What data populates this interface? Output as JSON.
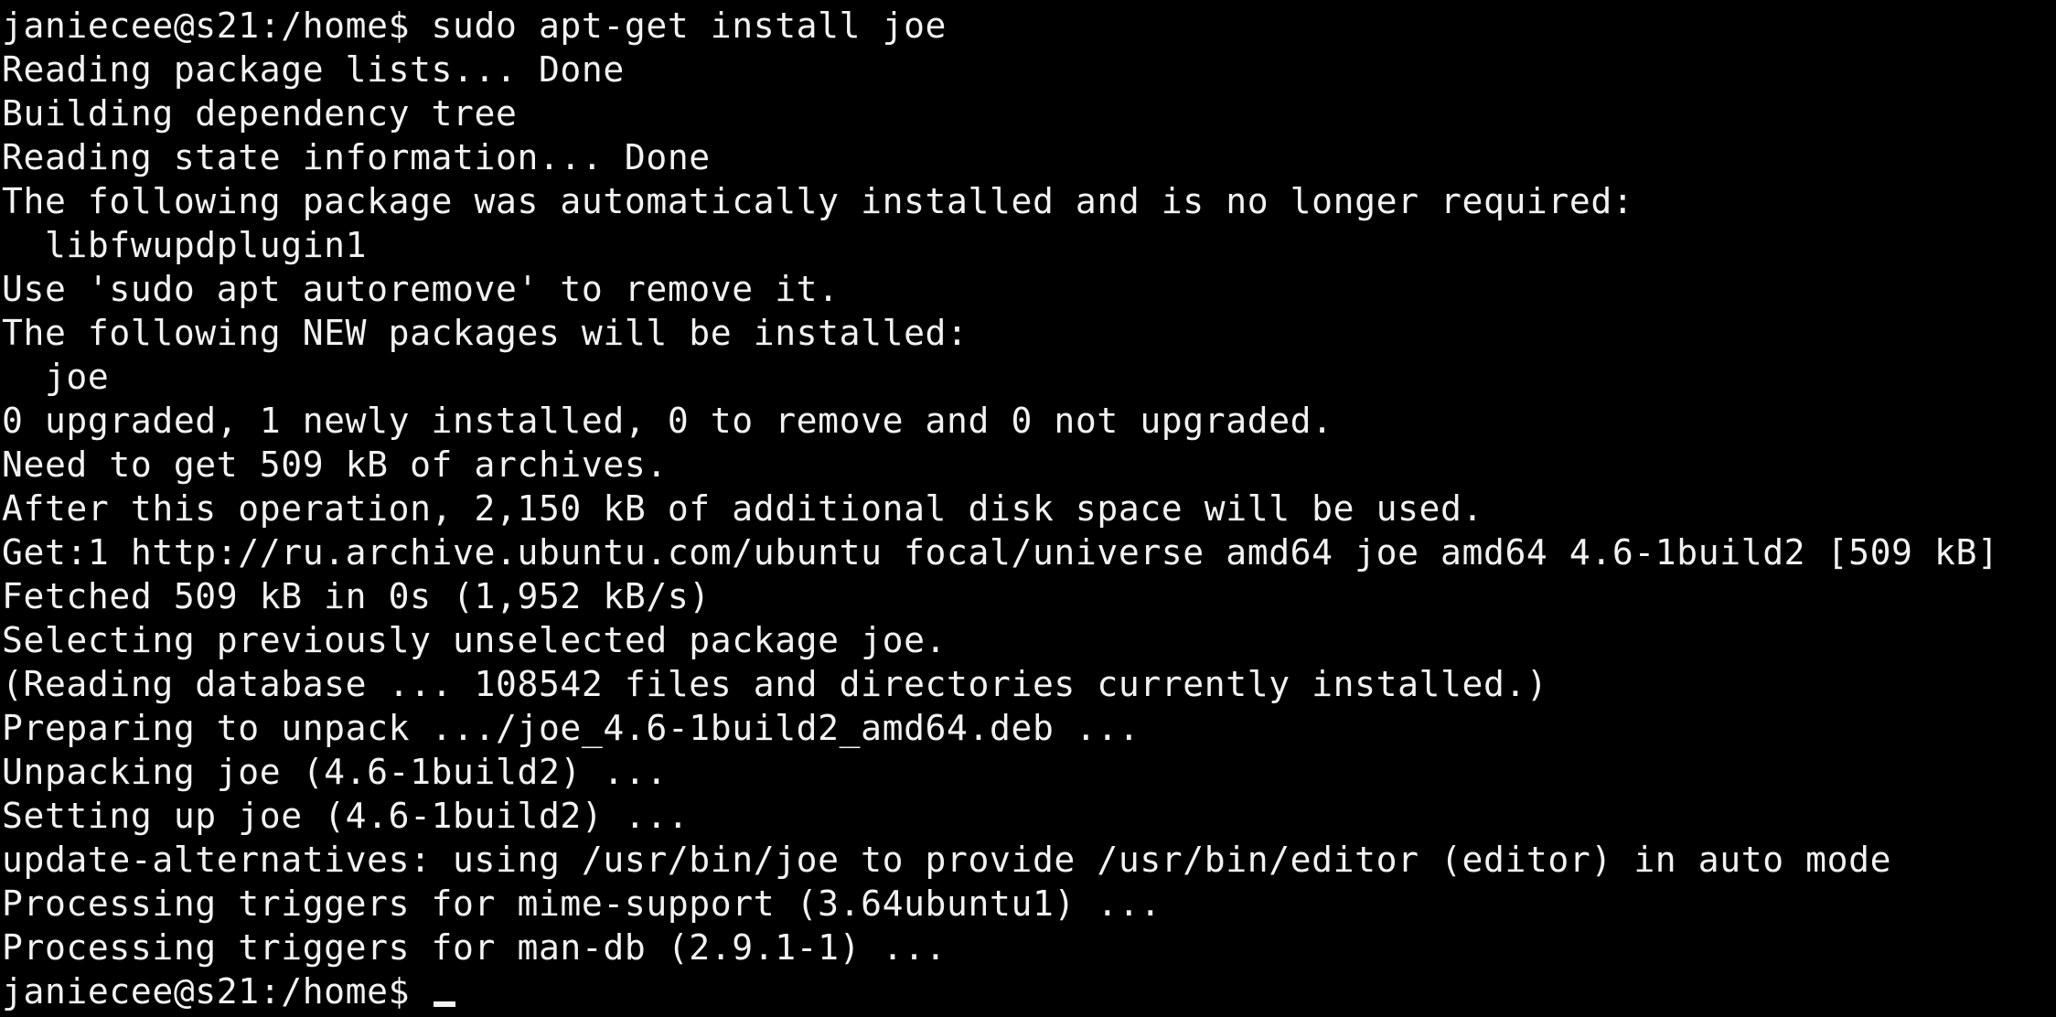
{
  "terminal": {
    "colors": {
      "background": "#000000",
      "foreground": "#f2f2f2"
    },
    "lines": [
      "janiecee@s21:/home$ sudo apt-get install joe",
      "Reading package lists... Done",
      "Building dependency tree",
      "Reading state information... Done",
      "The following package was automatically installed and is no longer required:",
      "  libfwupdplugin1",
      "Use 'sudo apt autoremove' to remove it.",
      "The following NEW packages will be installed:",
      "  joe",
      "0 upgraded, 1 newly installed, 0 to remove and 0 not upgraded.",
      "Need to get 509 kB of archives.",
      "After this operation, 2,150 kB of additional disk space will be used.",
      "Get:1 http://ru.archive.ubuntu.com/ubuntu focal/universe amd64 joe amd64 4.6-1build2 [509 kB]",
      "Fetched 509 kB in 0s (1,952 kB/s)",
      "Selecting previously unselected package joe.",
      "(Reading database ... 108542 files and directories currently installed.)",
      "Preparing to unpack .../joe_4.6-1build2_amd64.deb ...",
      "Unpacking joe (4.6-1build2) ...",
      "Setting up joe (4.6-1build2) ...",
      "update-alternatives: using /usr/bin/joe to provide /usr/bin/editor (editor) in auto mode",
      "Processing triggers for mime-support (3.64ubuntu1) ...",
      "Processing triggers for man-db (2.9.1-1) ..."
    ],
    "prompt": "janiecee@s21:/home$ "
  }
}
